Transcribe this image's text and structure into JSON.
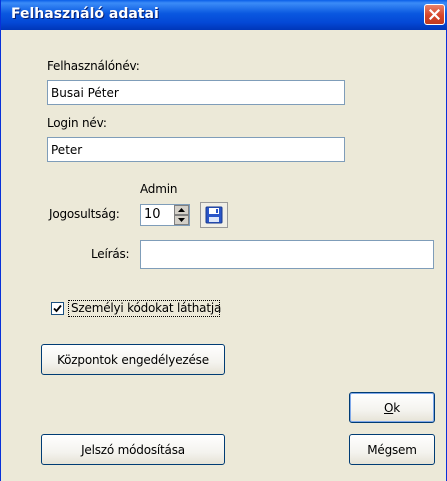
{
  "window": {
    "title": "Felhasználó adatai",
    "close_icon": "close-x-icon"
  },
  "form": {
    "username_label": "Felhasználónév:",
    "username_value": "Busai Péter",
    "login_label": "Login név:",
    "login_value": "Peter",
    "role_caption": "Admin",
    "permission_label": "Jogosultság:",
    "permission_value": "10",
    "description_label": "Leírás:",
    "description_value": "",
    "personal_codes_label": "Személyi kódokat láthatja",
    "personal_codes_checked": true
  },
  "buttons": {
    "enable_centers": "Központok engedélyezése",
    "ok_mnemonic": "O",
    "ok_rest": "k",
    "change_password": "Jelszó módosítása",
    "cancel": "Mégsem"
  },
  "colors": {
    "titlebar": "#0a58e0",
    "window_bg": "#ece9d8",
    "close_button": "#d6452a",
    "save_icon": "#2a55c8"
  }
}
